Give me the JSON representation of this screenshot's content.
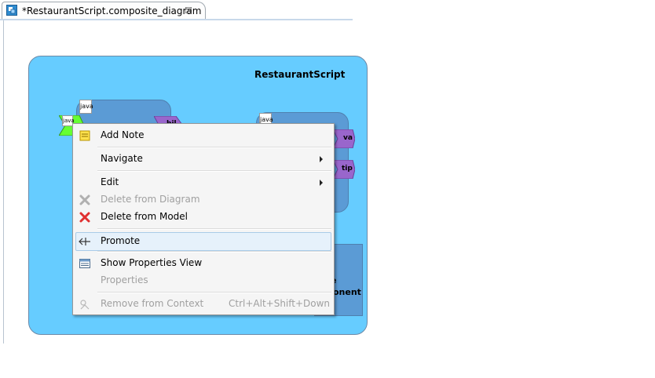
{
  "editor": {
    "tab_title": "*RestaurantScript.composite_diagram",
    "tab_close": "☒"
  },
  "diagram": {
    "composite_name": "RestaurantScript",
    "java_label": "java",
    "reference_labels": [
      "bil",
      "va",
      "tip"
    ],
    "component_label_partial_1": "e",
    "component_label_partial_2": "onent"
  },
  "context_menu": {
    "add_note": "Add Note",
    "navigate": "Navigate",
    "edit": "Edit",
    "delete_from_diagram": "Delete from Diagram",
    "delete_from_model": "Delete from Model",
    "promote": "Promote",
    "show_properties_view": "Show Properties View",
    "properties": "Properties",
    "remove_from_context": "Remove from Context",
    "remove_from_context_shortcut": "Ctrl+Alt+Shift+Down"
  },
  "colors": {
    "composite_fill": "#66ccff",
    "component_fill": "#5b9bd5",
    "reference_fill": "#9966cc",
    "service_fill": "#66ff33",
    "delete_red": "#e03030",
    "highlight": "#e6f1fb"
  }
}
